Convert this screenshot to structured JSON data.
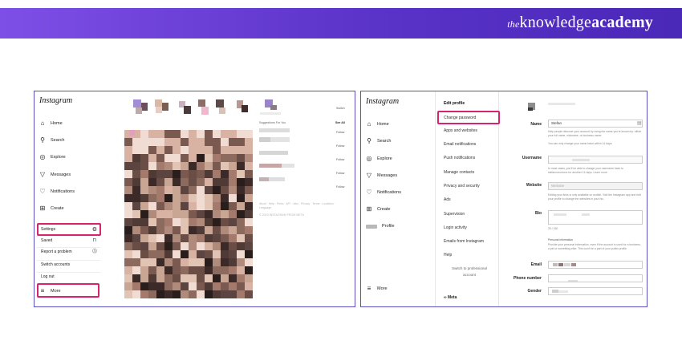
{
  "banner": {
    "brand_the": "the",
    "brand_knowledge": "knowledge",
    "brand_academy": "academy",
    "color": "#6a3fd8"
  },
  "left": {
    "logo": "Instagram",
    "nav": [
      {
        "label": "Home",
        "icon": "home-icon"
      },
      {
        "label": "Search",
        "icon": "search-icon"
      },
      {
        "label": "Explore",
        "icon": "compass-icon"
      },
      {
        "label": "Messages",
        "icon": "messenger-icon"
      },
      {
        "label": "Notifications",
        "icon": "heart-icon"
      },
      {
        "label": "Create",
        "icon": "plus-square-icon"
      }
    ],
    "menu": [
      {
        "label": "Settings",
        "icon": "gear-icon"
      },
      {
        "label": "Saved",
        "icon": "bookmark-icon"
      },
      {
        "label": "Report a problem",
        "icon": "report-icon"
      },
      {
        "label": "Switch accounts",
        "icon": ""
      },
      {
        "label": "Log out",
        "icon": ""
      }
    ],
    "more_label": "More",
    "switch_label": "Switch",
    "suggestions_title": "Suggestions For You",
    "see_all": "See All",
    "follow_label": "Follow",
    "footer_text": "About · Help · Press · API · Jobs · Privacy · Terms · Locations · Language",
    "copyright": "© 2023 INSTAGRAM FROM META"
  },
  "right": {
    "logo": "Instagram",
    "nav": [
      {
        "label": "Home",
        "icon": "home-icon"
      },
      {
        "label": "Search",
        "icon": "search-icon"
      },
      {
        "label": "Explore",
        "icon": "compass-icon"
      },
      {
        "label": "Messages",
        "icon": "messenger-icon"
      },
      {
        "label": "Notifications",
        "icon": "heart-icon"
      },
      {
        "label": "Create",
        "icon": "plus-square-icon"
      },
      {
        "label": "Profile",
        "icon": "avatar-icon"
      }
    ],
    "more_label": "More",
    "settings": [
      "Edit profile",
      "Change password",
      "Apps and websites",
      "Email notifications",
      "Push notifications",
      "Manage contacts",
      "Privacy and security",
      "Ads",
      "Supervision",
      "Login activity",
      "Emails from Instagram",
      "Help",
      "Switch to professional account"
    ],
    "meta_label": "∞ Meta",
    "change_photo": "Change profile photo",
    "form": {
      "name_label": "Name",
      "name_value": "Stefan",
      "name_help": "Help people discover your account by using the name you're known by: either your full name, nickname, or business name.",
      "name_help2": "You can only change your name twice within 14 days.",
      "username_label": "Username",
      "username_help": "In most cases, you'll be able to change your username back to stefanxxxxxxxxx for another 14 days. Learn more",
      "website_label": "Website",
      "website_placeholder": "Website",
      "website_help": "Editing your links is only available on mobile. Visit the Instagram app and edit your profile to change the websites in your bio.",
      "bio_label": "Bio",
      "bio_count": "25 / 150",
      "personal_title": "Personal information",
      "personal_help": "Provide your personal information, even if the account is used for a business, a pet or something else. This won't be a part of your public profile.",
      "email_label": "Email",
      "phone_label": "Phone number",
      "gender_label": "Gender"
    }
  }
}
